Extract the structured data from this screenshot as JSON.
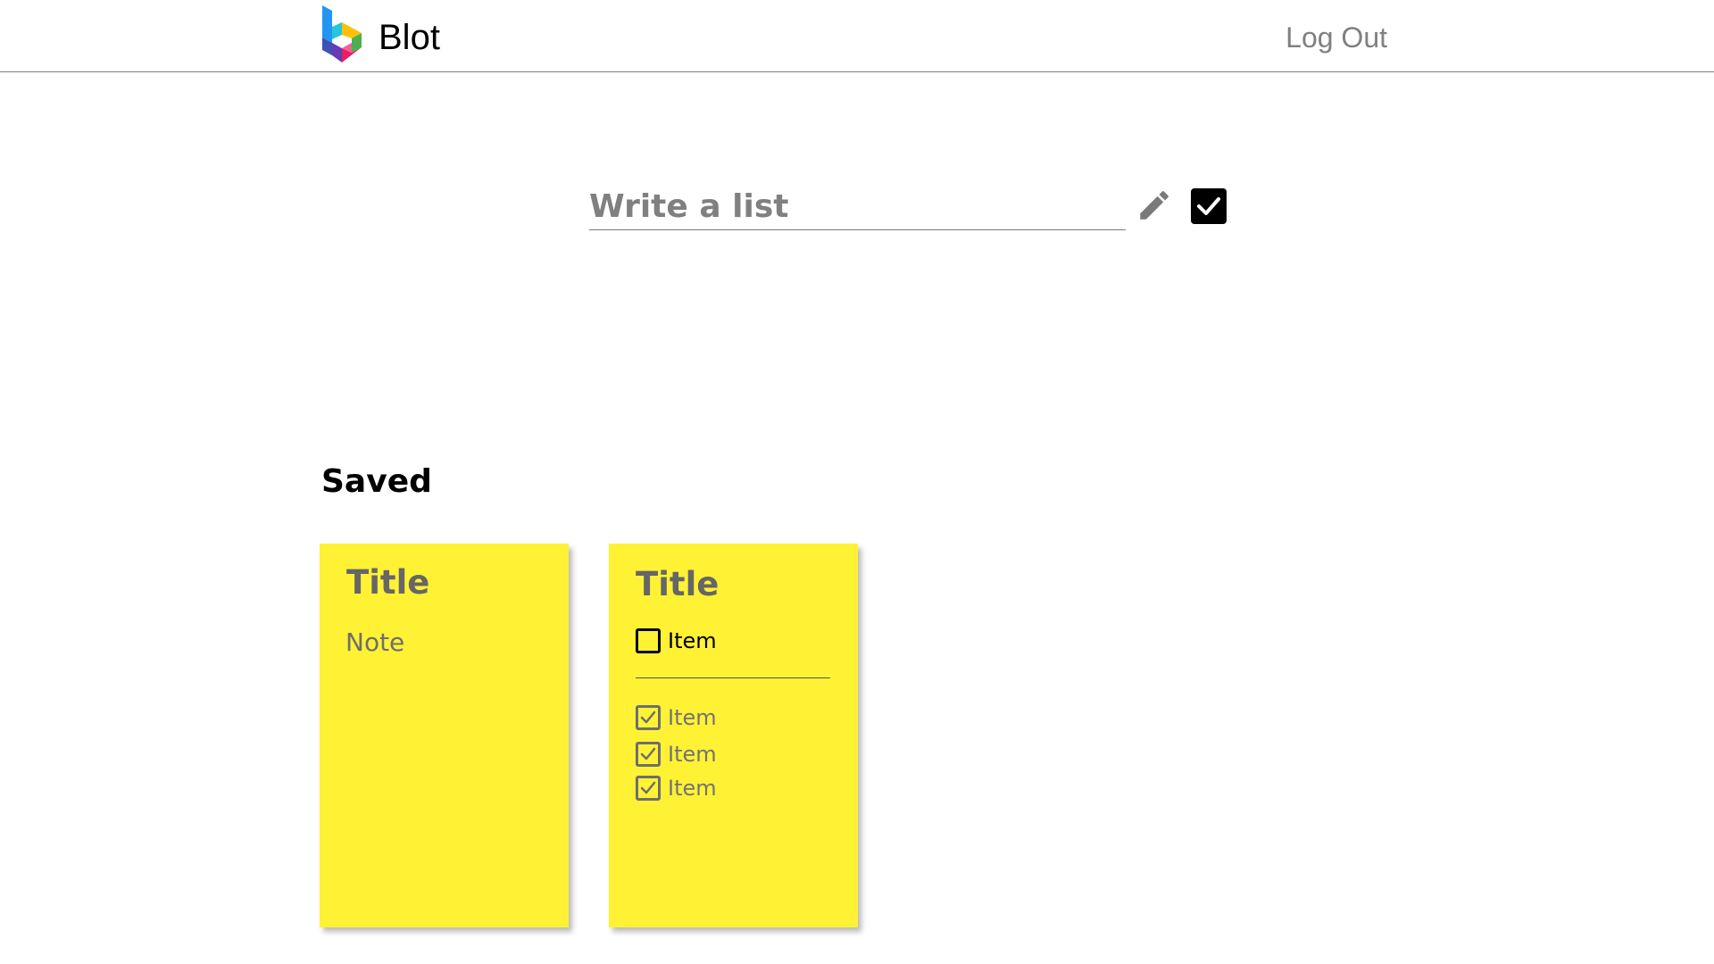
{
  "header": {
    "brand": "Blot",
    "logout_label": "Log Out"
  },
  "composer": {
    "placeholder": "Write a list",
    "value": ""
  },
  "saved": {
    "heading": "Saved",
    "cards": [
      {
        "type": "note",
        "title": "Title",
        "note": "Note"
      },
      {
        "type": "list",
        "title": "Title",
        "open_items": [
          {
            "label": "Item",
            "checked": false
          }
        ],
        "done_items": [
          {
            "label": "Item",
            "checked": true
          },
          {
            "label": "Item",
            "checked": true
          },
          {
            "label": "Item",
            "checked": true
          }
        ]
      }
    ]
  },
  "colors": {
    "card_background": "#fff235",
    "muted_text": "#808080",
    "accent_dark": "#000000"
  },
  "icons": {
    "logo": "blot-logo-icon",
    "edit": "pencil-icon",
    "mode_toggle": "checkbox-checked-icon",
    "unchecked": "checkbox-empty-icon",
    "checked": "checkbox-checked-icon"
  }
}
